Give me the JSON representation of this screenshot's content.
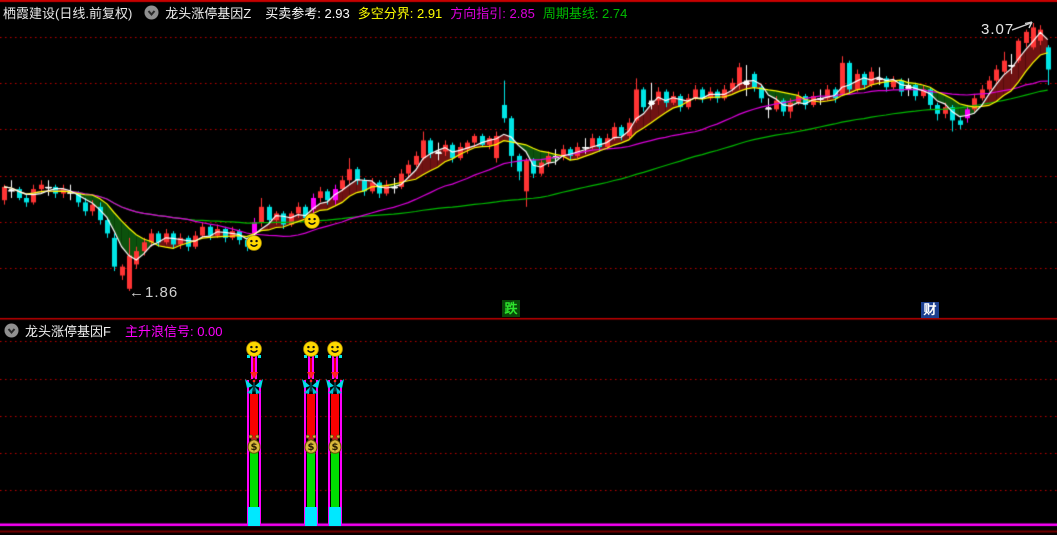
{
  "header_main": {
    "stock_title": "栖霞建设(日线.前复权)",
    "indicator_name": "龙头涨停基因Z"
  },
  "header_sub": {
    "indicator_name": "龙头涨停基因F",
    "signal_label": "主升浪信号:",
    "signal_value": "0.00",
    "signal_color": "#ff00ff"
  },
  "frame_lines": [
    {
      "y": 0,
      "h": 2,
      "color": "#c80000"
    },
    {
      "y": 318,
      "h": 1.5,
      "color": "#c80000"
    },
    {
      "y": 530.5,
      "h": 2,
      "color": "#7a0000"
    }
  ],
  "chart_data": [
    {
      "type": "candlestick",
      "x0": 4,
      "pitch": 7.35,
      "y_anchor": {
        "p1": 3.07,
        "y1": 23,
        "p2": 1.86,
        "y2": 291
      },
      "ylim": [
        1.74,
        3.09
      ],
      "gridlines_y": [
        37,
        83,
        129,
        176,
        222,
        268
      ],
      "grid_color": "#c00000",
      "ribbon_up_color": "#6f1212",
      "ribbon_down_color": "#0c520c",
      "candle_colors": {
        "r": "#ff3434",
        "c": "#00e6e6",
        "m": "#ff00ff",
        "w": "#ffffff"
      },
      "ma_lines": [
        {
          "label": "买卖参考",
          "value": "2.93",
          "period": 4,
          "color": "#ffffff"
        },
        {
          "label": "多空分界",
          "value": "2.91",
          "period": 9,
          "color": "#ffff00"
        },
        {
          "label": "方向指引",
          "value": "2.85",
          "period": 26,
          "color": "#dd00dd"
        },
        {
          "label": "周期基线",
          "value": "2.74",
          "period": 60,
          "color": "#00bb00"
        }
      ],
      "candles": [
        [
          2.27,
          2.34,
          2.25,
          2.33,
          "r"
        ],
        [
          2.31,
          2.36,
          2.28,
          2.32,
          "w"
        ],
        [
          2.32,
          2.33,
          2.27,
          2.28,
          "c"
        ],
        [
          2.28,
          2.3,
          2.24,
          2.26,
          "c"
        ],
        [
          2.26,
          2.34,
          2.25,
          2.32,
          "r"
        ],
        [
          2.32,
          2.36,
          2.3,
          2.34,
          "r"
        ],
        [
          2.33,
          2.36,
          2.29,
          2.33,
          "w"
        ],
        [
          2.33,
          2.34,
          2.28,
          2.3,
          "c"
        ],
        [
          2.3,
          2.34,
          2.28,
          2.32,
          "r"
        ],
        [
          2.31,
          2.34,
          2.27,
          2.3,
          "w"
        ],
        [
          2.3,
          2.31,
          2.24,
          2.26,
          "c"
        ],
        [
          2.26,
          2.28,
          2.2,
          2.22,
          "c"
        ],
        [
          2.22,
          2.27,
          2.2,
          2.25,
          "r"
        ],
        [
          2.24,
          2.26,
          2.16,
          2.18,
          "c"
        ],
        [
          2.18,
          2.19,
          2.1,
          2.12,
          "c"
        ],
        [
          2.1,
          2.12,
          1.95,
          1.97,
          "c"
        ],
        [
          1.93,
          1.98,
          1.91,
          1.97,
          "r"
        ],
        [
          1.87,
          2.1,
          1.86,
          2.02,
          "r"
        ],
        [
          1.98,
          2.06,
          1.96,
          2.04,
          "r"
        ],
        [
          2.04,
          2.1,
          2.02,
          2.08,
          "r"
        ],
        [
          2.08,
          2.14,
          2.06,
          2.12,
          "r"
        ],
        [
          2.12,
          2.13,
          2.06,
          2.08,
          "c"
        ],
        [
          2.08,
          2.14,
          2.07,
          2.12,
          "r"
        ],
        [
          2.12,
          2.13,
          2.05,
          2.07,
          "c"
        ],
        [
          2.07,
          2.12,
          2.05,
          2.1,
          "r"
        ],
        [
          2.1,
          2.11,
          2.04,
          2.06,
          "c"
        ],
        [
          2.06,
          2.13,
          2.05,
          2.11,
          "r"
        ],
        [
          2.11,
          2.17,
          2.1,
          2.15,
          "r"
        ],
        [
          2.15,
          2.16,
          2.09,
          2.11,
          "c"
        ],
        [
          2.11,
          2.16,
          2.1,
          2.14,
          "r"
        ],
        [
          2.14,
          2.15,
          2.08,
          2.1,
          "c"
        ],
        [
          2.1,
          2.15,
          2.09,
          2.13,
          "r"
        ],
        [
          2.13,
          2.14,
          2.07,
          2.09,
          "c"
        ],
        [
          2.09,
          2.1,
          2.04,
          2.06,
          "c"
        ],
        [
          2.12,
          2.19,
          2.1,
          2.17,
          "m"
        ],
        [
          2.17,
          2.28,
          2.15,
          2.24,
          "r"
        ],
        [
          2.24,
          2.25,
          2.17,
          2.18,
          "c"
        ],
        [
          2.18,
          2.22,
          2.16,
          2.21,
          "r"
        ],
        [
          2.21,
          2.22,
          2.14,
          2.16,
          "c"
        ],
        [
          2.16,
          2.22,
          2.15,
          2.21,
          "r"
        ],
        [
          2.21,
          2.26,
          2.19,
          2.24,
          "r"
        ],
        [
          2.24,
          2.25,
          2.17,
          2.19,
          "c"
        ],
        [
          2.23,
          2.3,
          2.21,
          2.28,
          "m"
        ],
        [
          2.28,
          2.33,
          2.26,
          2.31,
          "r"
        ],
        [
          2.31,
          2.32,
          2.25,
          2.27,
          "c"
        ],
        [
          2.27,
          2.34,
          2.25,
          2.32,
          "m"
        ],
        [
          2.32,
          2.38,
          2.31,
          2.36,
          "r"
        ],
        [
          2.36,
          2.46,
          2.34,
          2.41,
          "r"
        ],
        [
          2.41,
          2.42,
          2.34,
          2.36,
          "c"
        ],
        [
          2.36,
          2.37,
          2.29,
          2.31,
          "c"
        ],
        [
          2.31,
          2.37,
          2.3,
          2.35,
          "r"
        ],
        [
          2.35,
          2.36,
          2.28,
          2.3,
          "c"
        ],
        [
          2.3,
          2.36,
          2.29,
          2.34,
          "r"
        ],
        [
          2.33,
          2.37,
          2.3,
          2.33,
          "w"
        ],
        [
          2.33,
          2.41,
          2.32,
          2.39,
          "r"
        ],
        [
          2.39,
          2.45,
          2.37,
          2.43,
          "r"
        ],
        [
          2.43,
          2.49,
          2.42,
          2.47,
          "r"
        ],
        [
          2.46,
          2.58,
          2.45,
          2.54,
          "r"
        ],
        [
          2.54,
          2.55,
          2.46,
          2.48,
          "c"
        ],
        [
          2.48,
          2.53,
          2.45,
          2.49,
          "w"
        ],
        [
          2.49,
          2.54,
          2.47,
          2.52,
          "r"
        ],
        [
          2.52,
          2.53,
          2.44,
          2.46,
          "c"
        ],
        [
          2.46,
          2.53,
          2.45,
          2.51,
          "r"
        ],
        [
          2.5,
          2.54,
          2.48,
          2.53,
          "r"
        ],
        [
          2.53,
          2.57,
          2.51,
          2.56,
          "r"
        ],
        [
          2.56,
          2.57,
          2.51,
          2.52,
          "c"
        ],
        [
          2.52,
          2.56,
          2.5,
          2.55,
          "r"
        ],
        [
          2.46,
          2.58,
          2.44,
          2.56,
          "r"
        ],
        [
          2.7,
          2.81,
          2.62,
          2.64,
          "c"
        ],
        [
          2.64,
          2.65,
          2.42,
          2.47,
          "c"
        ],
        [
          2.47,
          2.48,
          2.36,
          2.4,
          "c"
        ],
        [
          2.31,
          2.46,
          2.24,
          2.45,
          "r"
        ],
        [
          2.45,
          2.46,
          2.37,
          2.39,
          "c"
        ],
        [
          2.39,
          2.45,
          2.38,
          2.44,
          "r"
        ],
        [
          2.44,
          2.49,
          2.42,
          2.47,
          "r"
        ],
        [
          2.46,
          2.5,
          2.43,
          2.47,
          "w"
        ],
        [
          2.47,
          2.52,
          2.45,
          2.5,
          "r"
        ],
        [
          2.5,
          2.51,
          2.45,
          2.47,
          "c"
        ],
        [
          2.47,
          2.53,
          2.46,
          2.51,
          "r"
        ],
        [
          2.51,
          2.55,
          2.48,
          2.51,
          "w"
        ],
        [
          2.51,
          2.57,
          2.5,
          2.55,
          "r"
        ],
        [
          2.55,
          2.56,
          2.49,
          2.51,
          "c"
        ],
        [
          2.51,
          2.57,
          2.5,
          2.55,
          "r"
        ],
        [
          2.55,
          2.62,
          2.54,
          2.6,
          "r"
        ],
        [
          2.6,
          2.61,
          2.54,
          2.56,
          "c"
        ],
        [
          2.56,
          2.64,
          2.55,
          2.62,
          "r"
        ],
        [
          2.63,
          2.82,
          2.62,
          2.77,
          "r"
        ],
        [
          2.77,
          2.78,
          2.67,
          2.69,
          "c"
        ],
        [
          2.7,
          2.8,
          2.68,
          2.72,
          "w"
        ],
        [
          2.72,
          2.78,
          2.7,
          2.76,
          "r"
        ],
        [
          2.76,
          2.77,
          2.69,
          2.71,
          "c"
        ],
        [
          2.71,
          2.76,
          2.7,
          2.74,
          "r"
        ],
        [
          2.74,
          2.75,
          2.67,
          2.69,
          "c"
        ],
        [
          2.69,
          2.75,
          2.68,
          2.73,
          "r"
        ],
        [
          2.73,
          2.79,
          2.72,
          2.77,
          "r"
        ],
        [
          2.77,
          2.78,
          2.71,
          2.73,
          "c"
        ],
        [
          2.73,
          2.78,
          2.72,
          2.76,
          "r"
        ],
        [
          2.76,
          2.77,
          2.71,
          2.73,
          "c"
        ],
        [
          2.73,
          2.79,
          2.72,
          2.77,
          "r"
        ],
        [
          2.77,
          2.82,
          2.76,
          2.8,
          "r"
        ],
        [
          2.79,
          2.89,
          2.77,
          2.87,
          "r"
        ],
        [
          2.81,
          2.88,
          2.74,
          2.79,
          "w"
        ],
        [
          2.84,
          2.85,
          2.76,
          2.78,
          "c"
        ],
        [
          2.78,
          2.79,
          2.71,
          2.73,
          "c"
        ],
        [
          2.69,
          2.73,
          2.64,
          2.68,
          "w"
        ],
        [
          2.68,
          2.74,
          2.67,
          2.72,
          "r"
        ],
        [
          2.72,
          2.73,
          2.65,
          2.67,
          "c"
        ],
        [
          2.67,
          2.73,
          2.64,
          2.71,
          "r"
        ],
        [
          2.71,
          2.76,
          2.7,
          2.74,
          "r"
        ],
        [
          2.74,
          2.75,
          2.68,
          2.7,
          "c"
        ],
        [
          2.7,
          2.76,
          2.69,
          2.74,
          "r"
        ],
        [
          2.73,
          2.77,
          2.7,
          2.73,
          "w"
        ],
        [
          2.73,
          2.79,
          2.72,
          2.77,
          "r"
        ],
        [
          2.77,
          2.78,
          2.71,
          2.73,
          "c"
        ],
        [
          2.75,
          2.92,
          2.74,
          2.89,
          "r"
        ],
        [
          2.89,
          2.9,
          2.75,
          2.77,
          "c"
        ],
        [
          2.77,
          2.86,
          2.76,
          2.84,
          "r"
        ],
        [
          2.84,
          2.85,
          2.77,
          2.79,
          "c"
        ],
        [
          2.79,
          2.87,
          2.78,
          2.85,
          "r"
        ],
        [
          2.82,
          2.87,
          2.79,
          2.82,
          "w"
        ],
        [
          2.82,
          2.83,
          2.76,
          2.78,
          "c"
        ],
        [
          2.78,
          2.83,
          2.77,
          2.81,
          "r"
        ],
        [
          2.81,
          2.82,
          2.74,
          2.76,
          "c"
        ],
        [
          2.77,
          2.82,
          2.74,
          2.79,
          "w"
        ],
        [
          2.79,
          2.8,
          2.72,
          2.74,
          "c"
        ],
        [
          2.74,
          2.79,
          2.73,
          2.77,
          "r"
        ],
        [
          2.77,
          2.78,
          2.68,
          2.7,
          "c"
        ],
        [
          2.7,
          2.71,
          2.63,
          2.66,
          "c"
        ],
        [
          2.66,
          2.71,
          2.64,
          2.69,
          "r"
        ],
        [
          2.69,
          2.7,
          2.58,
          2.63,
          "c"
        ],
        [
          2.63,
          2.65,
          2.59,
          2.61,
          "c"
        ],
        [
          2.64,
          2.7,
          2.62,
          2.68,
          "m"
        ],
        [
          2.68,
          2.75,
          2.67,
          2.73,
          "r"
        ],
        [
          2.73,
          2.79,
          2.72,
          2.77,
          "r"
        ],
        [
          2.77,
          2.83,
          2.76,
          2.81,
          "r"
        ],
        [
          2.81,
          2.88,
          2.8,
          2.86,
          "r"
        ],
        [
          2.85,
          2.94,
          2.84,
          2.9,
          "r"
        ],
        [
          2.88,
          2.93,
          2.84,
          2.88,
          "w"
        ],
        [
          2.9,
          3.0,
          2.89,
          2.99,
          "r"
        ],
        [
          2.98,
          3.04,
          2.96,
          3.03,
          "r"
        ],
        [
          2.96,
          3.07,
          2.95,
          3.05,
          "r"
        ],
        [
          2.99,
          3.06,
          2.97,
          3.04,
          "r"
        ],
        [
          2.96,
          2.97,
          2.79,
          2.86,
          "c"
        ]
      ],
      "markers": [
        {
          "x": 254,
          "y": 243
        },
        {
          "x": 312,
          "y": 221
        }
      ],
      "annotations": [
        {
          "name": "annotation-low",
          "text": "←1.86",
          "x": 129,
          "y": 284,
          "color": "#cfcfcf"
        },
        {
          "name": "annotation-high",
          "text": "3.07",
          "x": 981,
          "y": 21,
          "color": "#e8e8e8",
          "arrow": {
            "x": 1010,
            "y": 19
          }
        }
      ],
      "badges": [
        {
          "name": "event-badge-die",
          "text": "跌",
          "x": 502,
          "y": 300,
          "w": 18,
          "h": 17,
          "bg": "#084a08",
          "color": "#2ee52e"
        },
        {
          "name": "event-badge-cai",
          "text": "财",
          "x": 921,
          "y": 302,
          "w": 18,
          "h": 16,
          "bg": "#1c3f8f",
          "color": "#ffffff"
        }
      ]
    },
    {
      "type": "signal-towers",
      "towers": [
        {
          "x": 254
        },
        {
          "x": 311
        },
        {
          "x": 335
        }
      ],
      "gridlines_y": [
        341,
        379,
        416,
        453,
        490
      ],
      "grid_color": "#c00000",
      "baseline_y": 523.5,
      "baseline_color": "#ff00ff",
      "segment_colors": {
        "red": "#f80000",
        "green": "#00dd00",
        "cyan": "#00e8ff",
        "outline": "#ff00ff"
      }
    }
  ]
}
